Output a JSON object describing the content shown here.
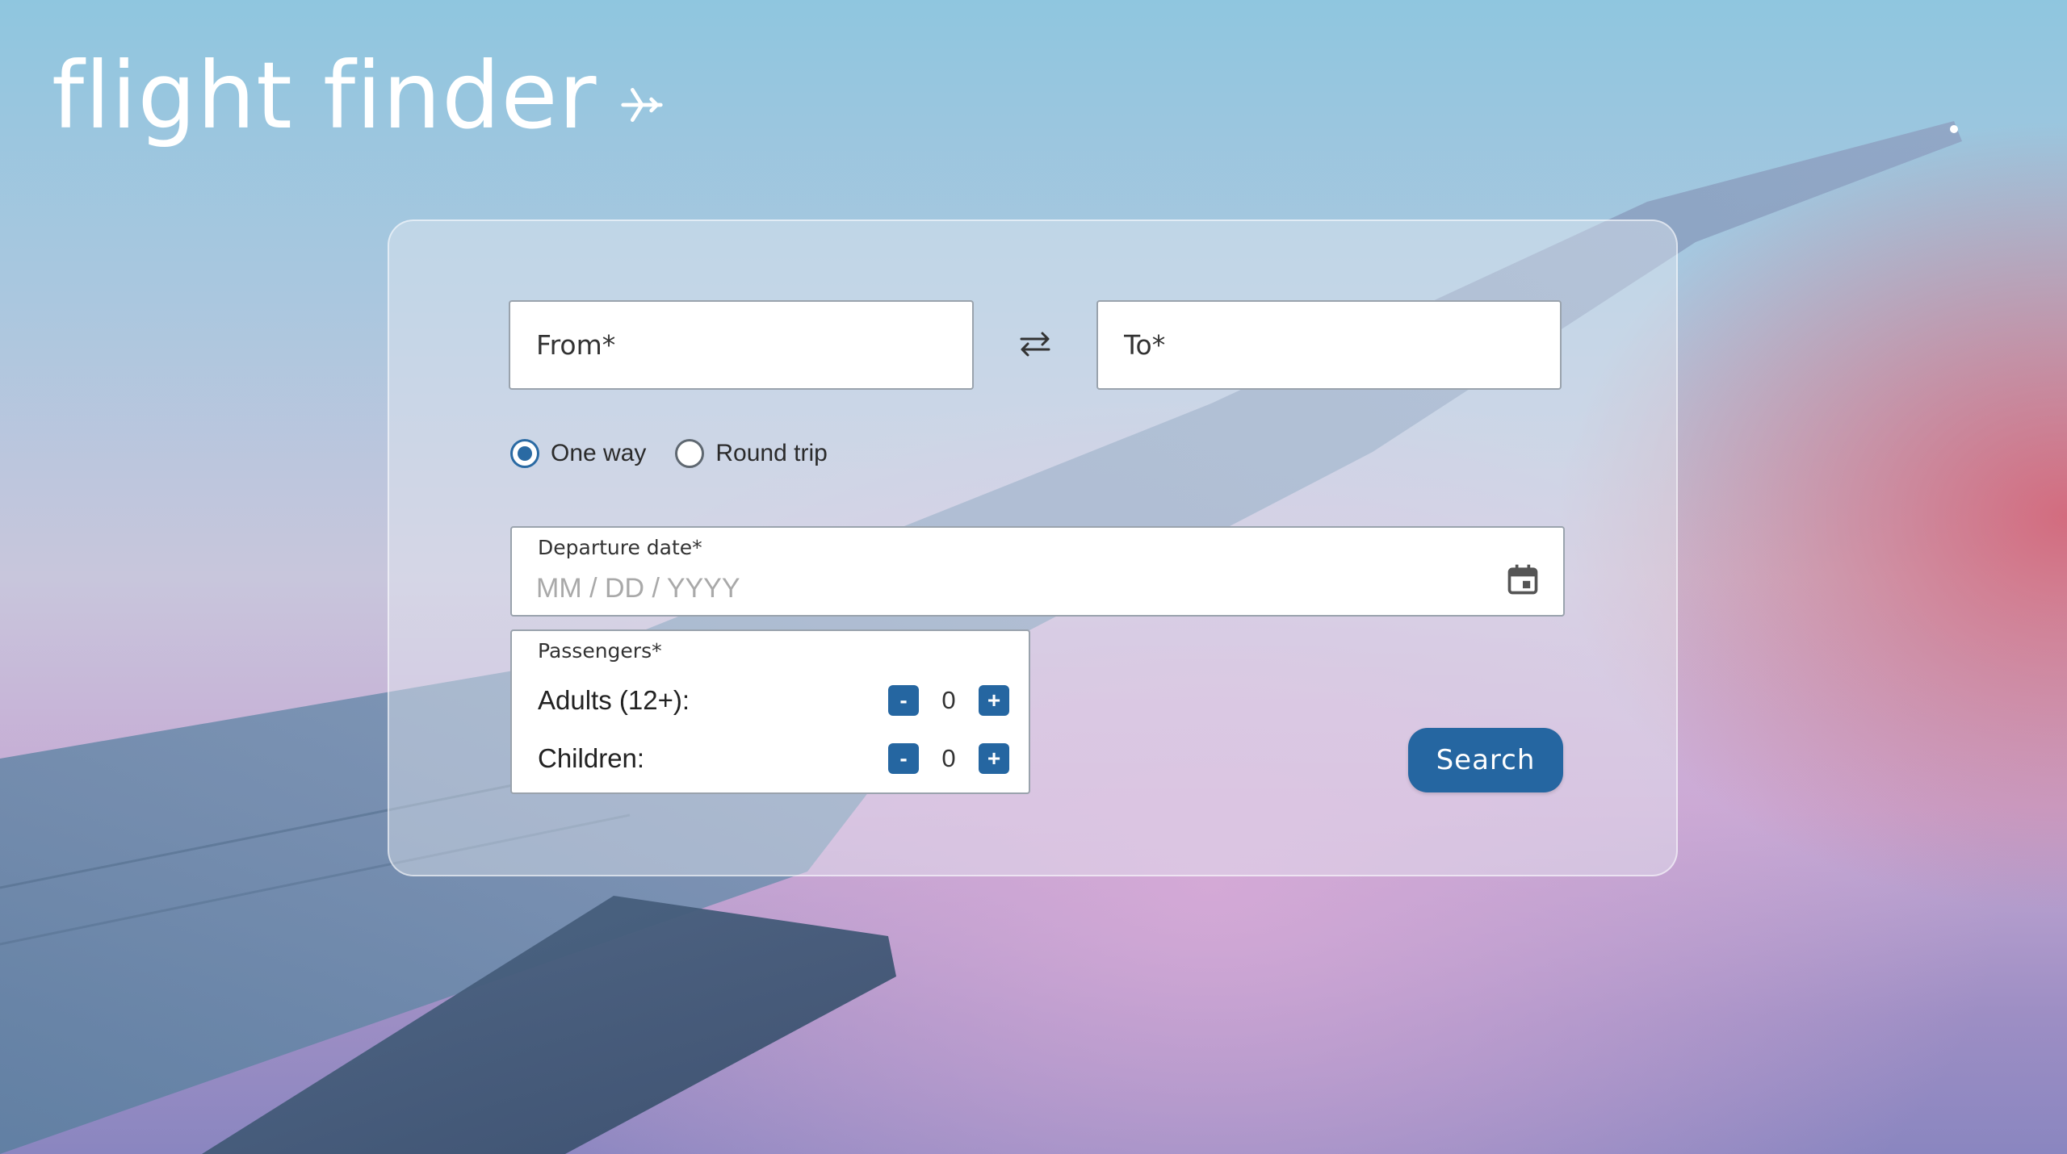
{
  "app": {
    "logo_text": "flight finder",
    "logo_icon": "airplane-icon"
  },
  "form": {
    "from_placeholder": "From*",
    "from_value": "",
    "to_placeholder": "To*",
    "to_value": "",
    "swap_icon": "swap-arrows-icon",
    "trip_type": {
      "options": [
        {
          "label": "One way",
          "checked": true
        },
        {
          "label": "Round trip",
          "checked": false
        }
      ]
    },
    "departure": {
      "label": "Departure date*",
      "placeholder": "MM / DD / YYYY",
      "value": "",
      "icon": "calendar-icon"
    },
    "passengers": {
      "label": "Passengers*",
      "adults_label": "Adults (12+):",
      "adults_value": "0",
      "children_label": "Children:",
      "children_value": "0",
      "minus_label": "-",
      "plus_label": "+"
    },
    "search_label": "Search"
  },
  "colors": {
    "accent": "#2566a1",
    "text": "#2b2b2b"
  }
}
